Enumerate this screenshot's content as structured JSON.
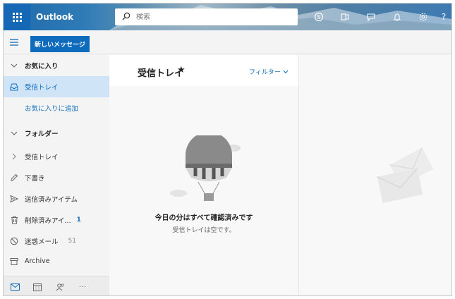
{
  "header": {
    "app_name": "Outlook",
    "search_placeholder": "検索",
    "icons": [
      "waffle-icon",
      "search-icon",
      "skype-icon",
      "office-icon",
      "feedback-icon",
      "bell-icon",
      "gear-icon",
      "help-icon"
    ],
    "help_label": "?"
  },
  "toolbar": {
    "new_message_label": "新しいメッセージ"
  },
  "sidebar": {
    "items": [
      {
        "label": "お気に入り",
        "icon": "chevron-down-icon",
        "type": "section"
      },
      {
        "label": "受信トレイ",
        "icon": "inbox-icon",
        "type": "selected"
      },
      {
        "label": "お気に入りに追加",
        "type": "link"
      },
      {
        "label": "フォルダー",
        "icon": "chevron-down-icon",
        "type": "section"
      },
      {
        "label": "受信トレイ",
        "icon": "chevron-right-icon"
      },
      {
        "label": "下書き",
        "icon": "pencil-icon"
      },
      {
        "label": "送信済みアイテム",
        "icon": "send-icon"
      },
      {
        "label": "削除済みアイ...",
        "icon": "trash-icon",
        "count": "1"
      },
      {
        "label": "迷惑メール",
        "icon": "block-icon",
        "count": "51"
      },
      {
        "label": "Archive",
        "icon": "archive-icon"
      }
    ],
    "footer_icons": [
      "mail-icon",
      "calendar-icon",
      "people-icon",
      "more-icon"
    ],
    "more_label": "···"
  },
  "list": {
    "title": "受信トレイ",
    "star": "★",
    "filter_label": "フィルター",
    "empty_title": "今日の分はすべて確認済みです",
    "empty_subtitle": "受信トレイは空です。"
  },
  "colors": {
    "accent": "#0f6cbd",
    "selected_bg": "#cfe5f7",
    "waffle_bg": "#1468b6"
  }
}
